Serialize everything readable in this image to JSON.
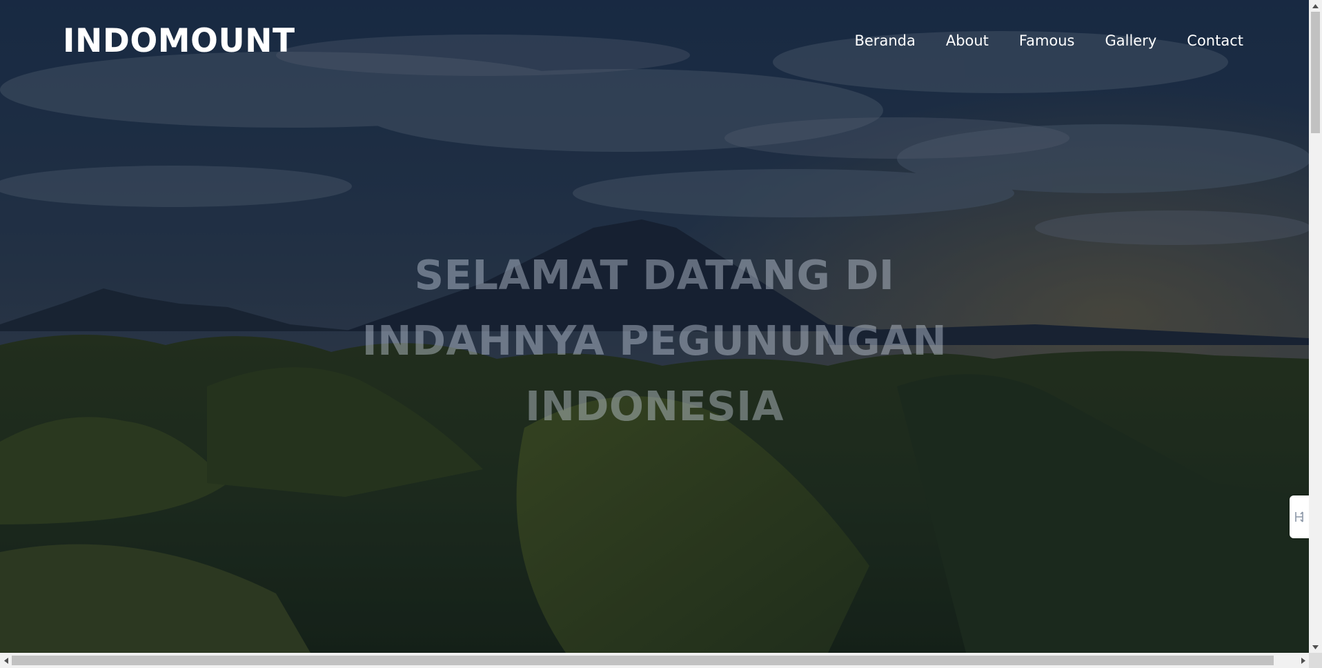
{
  "site": {
    "brand": "INDOMOUNT"
  },
  "nav": {
    "items": [
      {
        "label": "Beranda"
      },
      {
        "label": "About"
      },
      {
        "label": "Famous"
      },
      {
        "label": "Gallery"
      },
      {
        "label": "Contact"
      }
    ]
  },
  "hero": {
    "headline_lines": [
      "SELAMAT DATANG DI",
      "INDAHNYA PEGUNUNGAN",
      "INDONESIA"
    ],
    "background": "mountain-landscape-image"
  },
  "side_widget": {
    "icon": "toolbar-toggle-icon"
  },
  "colors": {
    "overlay": "#0b1626",
    "headline": "#9aa8b8",
    "text": "#ffffff",
    "scrollbar_track": "#f1f1f1",
    "scrollbar_thumb": "#c1c1c1"
  }
}
